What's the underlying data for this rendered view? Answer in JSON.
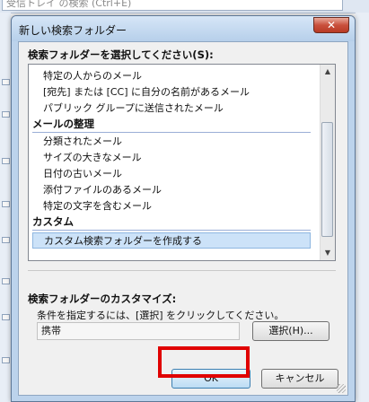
{
  "background": {
    "search_placeholder": "受信トレイ の検索 (Ctrl+E)"
  },
  "dialog": {
    "title": "新しい検索フォルダー",
    "close_icon": "✕",
    "select_label": "検索フォルダーを選択してください(S):",
    "list": {
      "items_top": [
        "特定の人からのメール",
        "[宛先] または [CC] に自分の名前があるメール",
        "パブリック グループに送信されたメール"
      ],
      "group_organize": "メールの整理",
      "items_organize": [
        "分類されたメール",
        "サイズの大きなメール",
        "日付の古いメール",
        "添付ファイルのあるメール",
        "特定の文字を含むメール"
      ],
      "group_custom": "カスタム",
      "items_custom": [
        "カスタム検索フォルダーを作成する"
      ]
    },
    "customize_label": "検索フォルダーのカスタマイズ:",
    "hint": "条件を指定するには、[選択] をクリックしてください。",
    "criteria_value": "携帯",
    "choose_button": "選択(H)...",
    "ok_button": "OK",
    "cancel_button": "キャンセル"
  },
  "colors": {
    "highlight": "#e00000",
    "selection": "#cce2f8",
    "title_bar": "#bcd3ec"
  }
}
